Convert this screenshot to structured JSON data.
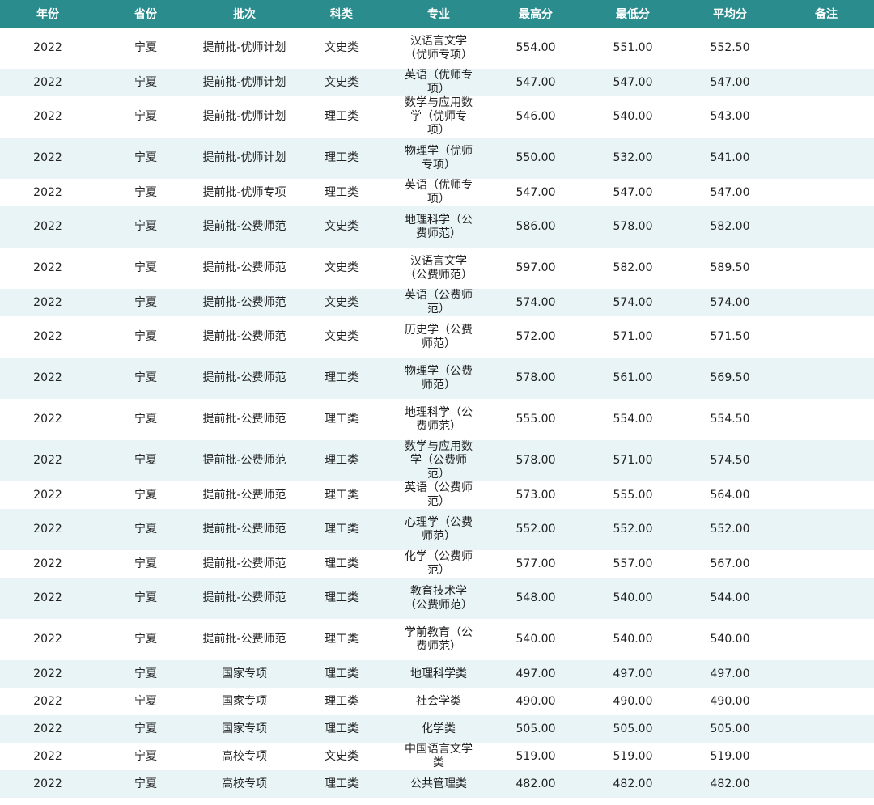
{
  "headers": [
    "年份",
    "省份",
    "批次",
    "科类",
    "专业",
    "最高分",
    "最低分",
    "平均分",
    "备注"
  ],
  "rows": [
    [
      "2022",
      "宁夏",
      "提前批-优师计划",
      "文史类",
      "汉语言文学（优师专项）",
      "554.00",
      "551.00",
      "552.50",
      ""
    ],
    [
      "2022",
      "宁夏",
      "提前批-优师计划",
      "文史类",
      "英语（优师专项）",
      "547.00",
      "547.00",
      "547.00",
      ""
    ],
    [
      "2022",
      "宁夏",
      "提前批-优师计划",
      "理工类",
      "数学与应用数学（优师专项）",
      "546.00",
      "540.00",
      "543.00",
      ""
    ],
    [
      "2022",
      "宁夏",
      "提前批-优师计划",
      "理工类",
      "物理学（优师专项）",
      "550.00",
      "532.00",
      "541.00",
      ""
    ],
    [
      "2022",
      "宁夏",
      "提前批-优师专项",
      "理工类",
      "英语（优师专项）",
      "547.00",
      "547.00",
      "547.00",
      ""
    ],
    [
      "2022",
      "宁夏",
      "提前批-公费师范",
      "文史类",
      "地理科学（公费师范）",
      "586.00",
      "578.00",
      "582.00",
      ""
    ],
    [
      "2022",
      "宁夏",
      "提前批-公费师范",
      "文史类",
      "汉语言文学（公费师范）",
      "597.00",
      "582.00",
      "589.50",
      ""
    ],
    [
      "2022",
      "宁夏",
      "提前批-公费师范",
      "文史类",
      "英语（公费师范）",
      "574.00",
      "574.00",
      "574.00",
      ""
    ],
    [
      "2022",
      "宁夏",
      "提前批-公费师范",
      "文史类",
      "历史学（公费师范）",
      "572.00",
      "571.00",
      "571.50",
      ""
    ],
    [
      "2022",
      "宁夏",
      "提前批-公费师范",
      "理工类",
      "物理学（公费师范）",
      "578.00",
      "561.00",
      "569.50",
      ""
    ],
    [
      "2022",
      "宁夏",
      "提前批-公费师范",
      "理工类",
      "地理科学（公费师范）",
      "555.00",
      "554.00",
      "554.50",
      ""
    ],
    [
      "2022",
      "宁夏",
      "提前批-公费师范",
      "理工类",
      "数学与应用数学（公费师范）",
      "578.00",
      "571.00",
      "574.50",
      ""
    ],
    [
      "2022",
      "宁夏",
      "提前批-公费师范",
      "理工类",
      "英语（公费师范）",
      "573.00",
      "555.00",
      "564.00",
      ""
    ],
    [
      "2022",
      "宁夏",
      "提前批-公费师范",
      "理工类",
      "心理学（公费师范）",
      "552.00",
      "552.00",
      "552.00",
      ""
    ],
    [
      "2022",
      "宁夏",
      "提前批-公费师范",
      "理工类",
      "化学（公费师范）",
      "577.00",
      "557.00",
      "567.00",
      ""
    ],
    [
      "2022",
      "宁夏",
      "提前批-公费师范",
      "理工类",
      "教育技术学（公费师范）",
      "548.00",
      "540.00",
      "544.00",
      ""
    ],
    [
      "2022",
      "宁夏",
      "提前批-公费师范",
      "理工类",
      "学前教育（公费师范）",
      "540.00",
      "540.00",
      "540.00",
      ""
    ],
    [
      "2022",
      "宁夏",
      "国家专项",
      "理工类",
      "地理科学类",
      "497.00",
      "497.00",
      "497.00",
      ""
    ],
    [
      "2022",
      "宁夏",
      "国家专项",
      "理工类",
      "社会学类",
      "490.00",
      "490.00",
      "490.00",
      ""
    ],
    [
      "2022",
      "宁夏",
      "国家专项",
      "理工类",
      "化学类",
      "505.00",
      "505.00",
      "505.00",
      ""
    ],
    [
      "2022",
      "宁夏",
      "高校专项",
      "文史类",
      "中国语言文学类",
      "519.00",
      "519.00",
      "519.00",
      ""
    ],
    [
      "2022",
      "宁夏",
      "高校专项",
      "理工类",
      "公共管理类",
      "482.00",
      "482.00",
      "482.00",
      ""
    ]
  ]
}
